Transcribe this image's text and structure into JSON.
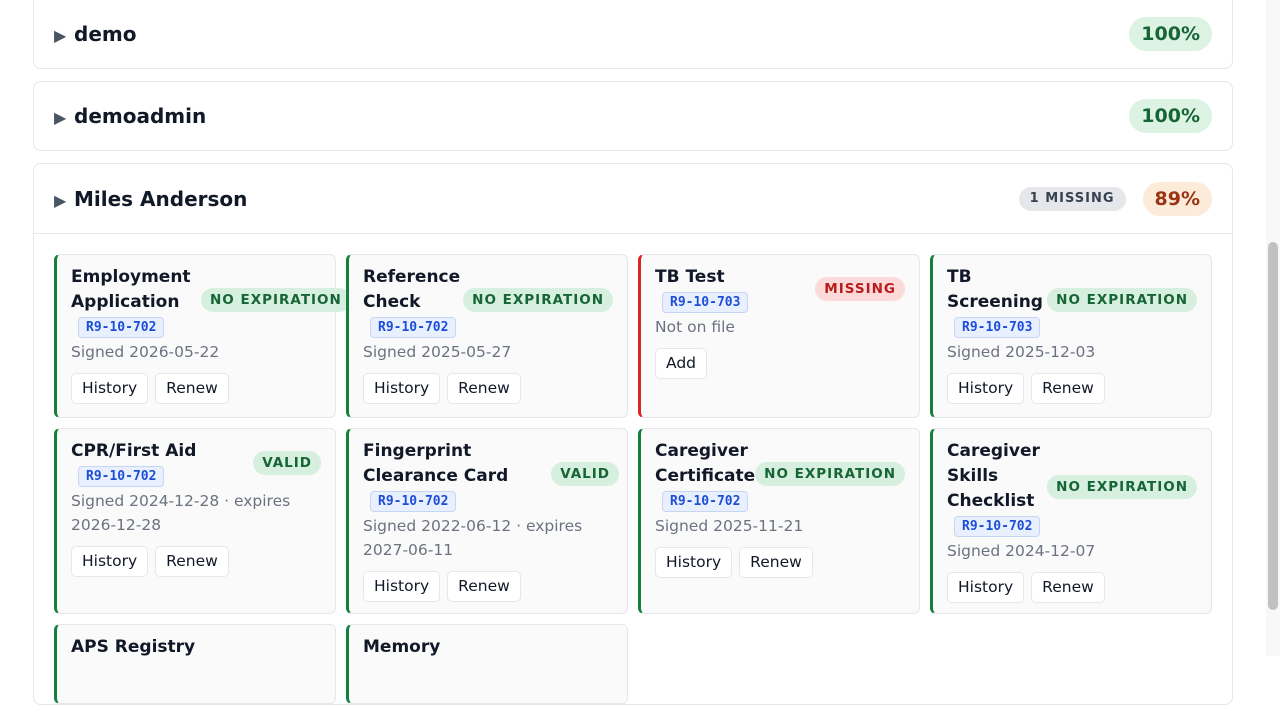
{
  "groups": [
    {
      "name": "demo",
      "percent": "100%"
    },
    {
      "name": "demoadmin",
      "percent": "100%"
    },
    {
      "name": "Miles Anderson",
      "missing_badge": "1 MISSING",
      "percent": "89%",
      "cards": [
        {
          "title": "Employment Application",
          "status": "NO EXPIRATION",
          "code": "R9-10-702",
          "signed": "Signed 2026-05-22",
          "buttons": [
            "History",
            "Renew"
          ]
        },
        {
          "title": "Reference Check",
          "status": "NO EXPIRATION",
          "code": "R9-10-702",
          "signed": "Signed 2025-05-27",
          "buttons": [
            "History",
            "Renew"
          ]
        },
        {
          "title": "TB Test",
          "status": "MISSING",
          "code": "R9-10-703",
          "signed": "Not on file",
          "buttons": [
            "Add"
          ]
        },
        {
          "title": "TB Screening",
          "status": "NO EXPIRATION",
          "code": "R9-10-703",
          "signed": "Signed 2025-12-03",
          "buttons": [
            "History",
            "Renew"
          ]
        },
        {
          "title": "CPR/First Aid",
          "status": "VALID",
          "code": "R9-10-702",
          "signed": "Signed 2024-12-28 · expires 2026-12-28",
          "buttons": [
            "History",
            "Renew"
          ]
        },
        {
          "title": "Fingerprint Clearance Card",
          "status": "VALID",
          "code": "R9-10-702",
          "signed": "Signed 2022-06-12 · expires 2027-06-11",
          "buttons": [
            "History",
            "Renew"
          ]
        },
        {
          "title": "Caregiver Certificate",
          "status": "NO EXPIRATION",
          "code": "R9-10-702",
          "signed": "Signed 2025-11-21",
          "buttons": [
            "History",
            "Renew"
          ]
        },
        {
          "title": "Caregiver Skills Checklist",
          "status": "NO EXPIRATION",
          "code": "R9-10-702",
          "signed": "Signed 2024-12-07",
          "buttons": [
            "History",
            "Renew"
          ]
        },
        {
          "title": "APS Registry"
        },
        {
          "title": "Memory"
        }
      ]
    }
  ],
  "colors": {
    "valid_border": "#15803d",
    "missing_border": "#dc2626",
    "accent_code": "#1d4ed8"
  }
}
